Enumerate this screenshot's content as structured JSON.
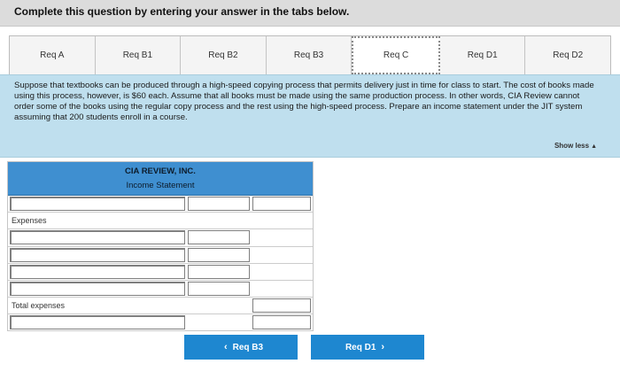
{
  "instruction": "Complete this question by entering your answer in the tabs below.",
  "tabs": [
    {
      "label": "Req A"
    },
    {
      "label": "Req B1"
    },
    {
      "label": "Req B2"
    },
    {
      "label": "Req B3"
    },
    {
      "label": "Req C",
      "active": true
    },
    {
      "label": "Req D1"
    },
    {
      "label": "Req D2"
    }
  ],
  "question": "Suppose that textbooks can be produced through a high-speed copying process that permits delivery just in time for class to start. The cost of books made using this process, however, is $60 each. Assume that all books must be made using the same production process. In other words, CIA Review cannot order some of the books using the regular copy process and the rest using the high-speed process. Prepare an income statement under the JIT system assuming that 200 students enroll in a course.",
  "show_less": "Show less",
  "statement": {
    "company": "CIA REVIEW, INC.",
    "title": "Income Statement",
    "expenses_label": "Expenses",
    "total_expenses_label": "Total expenses"
  },
  "nav": {
    "prev_label": "Req B3",
    "next_label": "Req D1"
  },
  "colors": {
    "panel_bg": "#bfdfee",
    "statement_header": "#3f8fd0",
    "nav_button": "#1e87d0"
  }
}
